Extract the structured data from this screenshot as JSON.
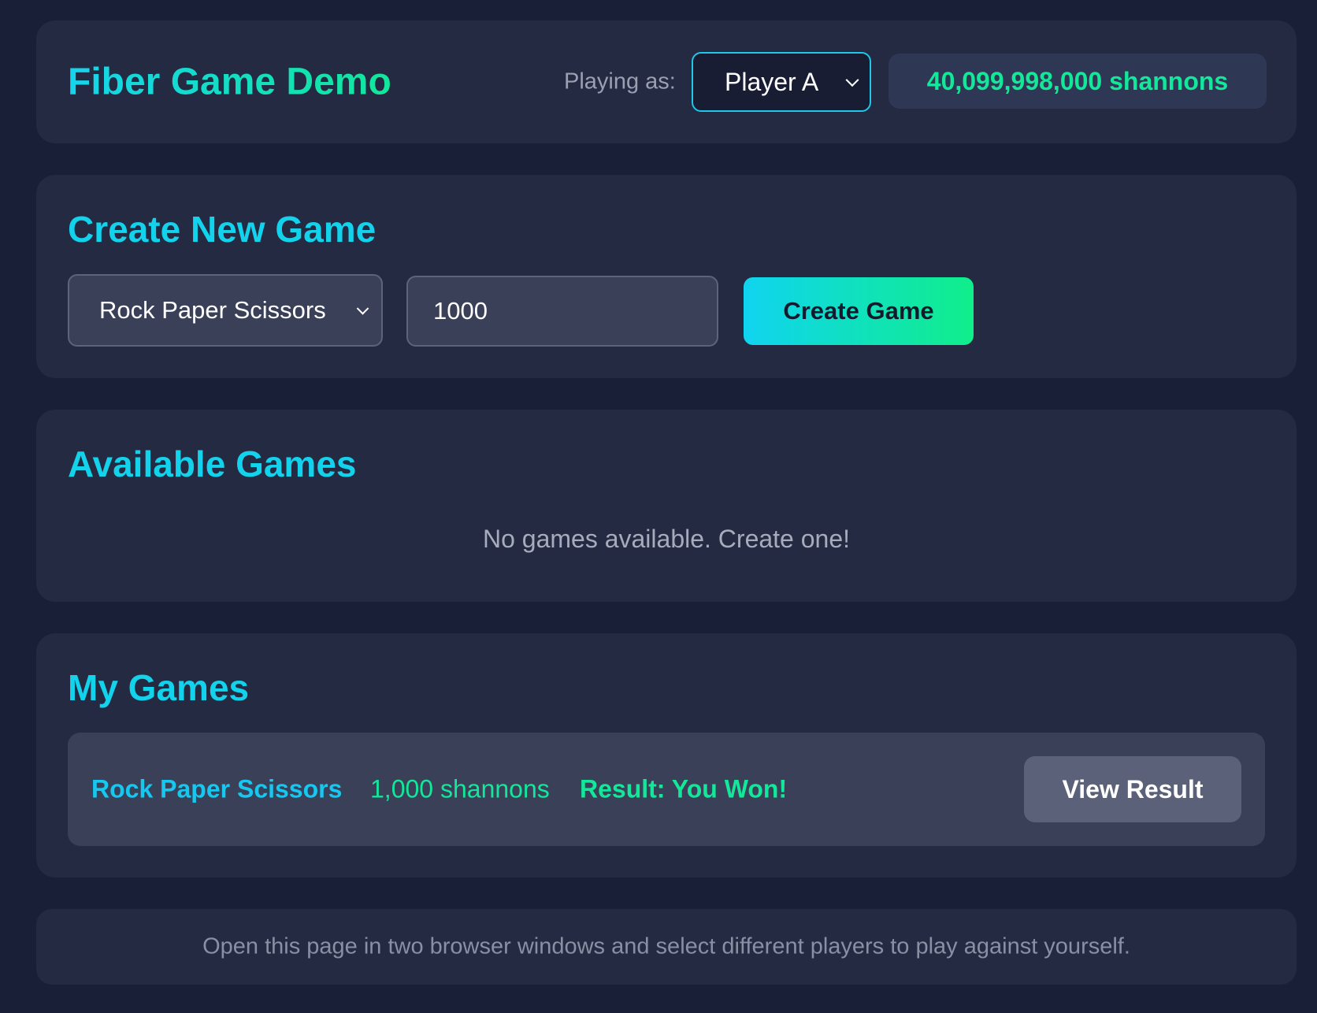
{
  "header": {
    "app_title": "Fiber Game Demo",
    "playing_as_label": "Playing as:",
    "player_selected": "Player A",
    "balance": "40,099,998,000 shannons"
  },
  "create": {
    "title": "Create New Game",
    "game_type_selected": "Rock Paper Scissors",
    "stake_value": "1000",
    "create_label": "Create Game"
  },
  "available": {
    "title": "Available Games",
    "empty_message": "No games available. Create one!"
  },
  "my_games": {
    "title": "My Games",
    "rows": [
      {
        "name": "Rock Paper Scissors",
        "stake": "1,000 shannons",
        "result": "Result: You Won!",
        "action_label": "View Result"
      }
    ]
  },
  "footer": {
    "text": "Open this page in two browser windows and select different players to play against yourself."
  },
  "colors": {
    "background": "#1a1f38",
    "card": "#232a42",
    "accent_cyan": "#12d2ec",
    "accent_green": "#12e79a"
  }
}
